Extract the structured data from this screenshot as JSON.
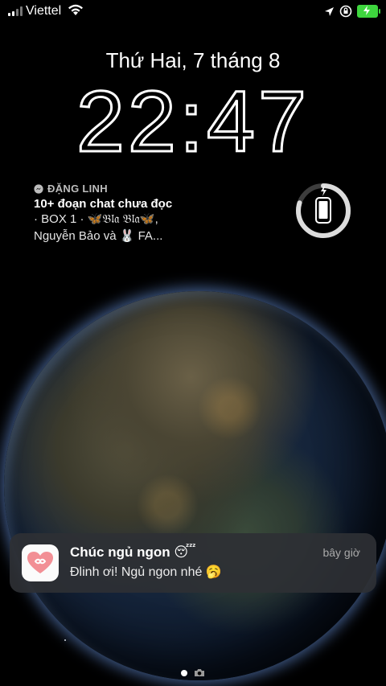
{
  "status_bar": {
    "carrier": "Viettel",
    "icons": [
      "signal-icon",
      "wifi-icon",
      "location-arrow-icon",
      "orientation-lock-icon",
      "battery-charging-icon"
    ],
    "battery_color": "#3ed63e"
  },
  "lockscreen": {
    "date": "Thứ Hai, 7 tháng 8",
    "time": "22:47"
  },
  "messenger_widget": {
    "app_icon": "messenger-icon",
    "sender": "ĐẶNG LINH",
    "title": "10+ đoạn chat chưa đọc",
    "line1": "· BOX 1 · 🦋𝔅𝔩𝔞 𝔅𝔩𝔞🦋,",
    "line2": "Nguyễn Bảo và 🐰 FA..."
  },
  "battery_widget": {
    "icon": "phone-charging-icon",
    "level_fraction": 0.8
  },
  "notification": {
    "app_icon": "heart-infinity-icon",
    "title": "Chúc ngủ ngon 😴",
    "time": "bây giờ",
    "body": "Đlinh ơi! Ngủ ngon nhé 🥱"
  },
  "pager": {
    "icons": [
      "page-dot-icon",
      "camera-icon"
    ]
  }
}
